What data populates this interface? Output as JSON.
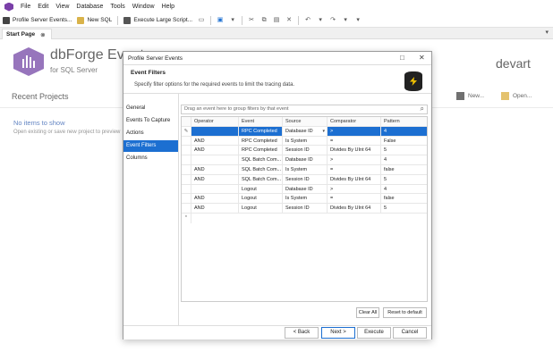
{
  "menu": [
    "File",
    "Edit",
    "View",
    "Database",
    "Tools",
    "Window",
    "Help"
  ],
  "toolbar": {
    "profile": "Profile Server Events...",
    "new_sql": "New SQL",
    "execute_large": "Execute Large Script..."
  },
  "tab": {
    "label": "Start Page",
    "pin": "⊗"
  },
  "start": {
    "brand": "dbForge Events",
    "brand_sub": "for SQL Server",
    "devart": "devart",
    "recent_projects": "Recent Projects",
    "no_items": "No items to show",
    "open_existing": "Open existing or save new project to preview",
    "new_label": "New...",
    "open_label": "Open..."
  },
  "dialog": {
    "title": "Profile Server Events",
    "header_title": "Event Filters",
    "header_sub": "Specify filter options for the required events to limit the tracing data.",
    "nav": [
      "General",
      "Events To Capture",
      "Actions",
      "Event Filters",
      "Columns"
    ],
    "selected_nav": "Event Filters",
    "group_placeholder": "Drag an event here to group filters by that event",
    "columns": [
      "Operator",
      "Event",
      "Source",
      "Comparator",
      "Pattern"
    ],
    "rows": [
      {
        "op": "",
        "event": "RPC Completed",
        "source": "Database ID",
        "comp": ">",
        "pattern": "4"
      },
      {
        "op": "AND",
        "event": "RPC Completed",
        "source": "Is System",
        "comp": "=",
        "pattern": "False"
      },
      {
        "op": "AND",
        "event": "RPC Completed",
        "source": "Session ID",
        "comp": "Divides By UInt 64",
        "pattern": "5"
      },
      {
        "op": "",
        "event": "SQL Batch Com...",
        "source": "Database ID",
        "comp": ">",
        "pattern": "4"
      },
      {
        "op": "AND",
        "event": "SQL Batch Com...",
        "source": "Is System",
        "comp": "=",
        "pattern": "false"
      },
      {
        "op": "AND",
        "event": "SQL Batch Com...",
        "source": "Session ID",
        "comp": "Divides By UInt 64",
        "pattern": "5"
      },
      {
        "op": "",
        "event": "Logout",
        "source": "Database ID",
        "comp": ">",
        "pattern": "4"
      },
      {
        "op": "AND",
        "event": "Logout",
        "source": "Is System",
        "comp": "=",
        "pattern": "false"
      },
      {
        "op": "AND",
        "event": "Logout",
        "source": "Session ID",
        "comp": "Divides By UInt 64",
        "pattern": "5"
      }
    ],
    "clear_all": "Clear All",
    "reset": "Reset to default",
    "back": "< Back",
    "next": "Next >",
    "execute": "Execute",
    "cancel": "Cancel"
  },
  "colors": {
    "accent": "#1c6fd1",
    "brand": "#6a3aa0"
  }
}
